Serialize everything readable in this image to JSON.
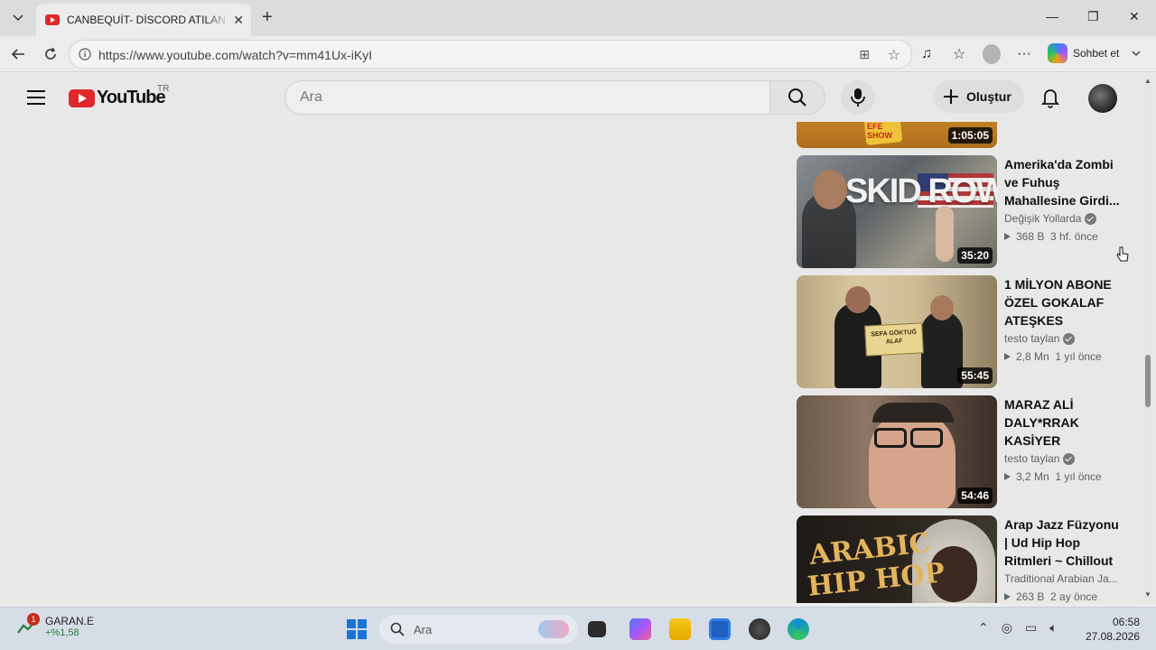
{
  "browser": {
    "tab": {
      "title": "CANBEQUİT- DİSCORD ATILAN VİDEO"
    },
    "address": {
      "url": "https://www.youtube.com/watch?v=mm41Ux-iKyI"
    },
    "chat_label": "Sohbet et"
  },
  "youtube": {
    "logo_text": "YouTube",
    "region": "TR",
    "search": {
      "placeholder": "Ara"
    },
    "create_label": "Oluştur"
  },
  "recommendations": [
    {
      "duration": "1:05:05",
      "title": "",
      "channel": "",
      "views": "",
      "age": ""
    },
    {
      "duration": "35:20",
      "title": "Amerika'da Zombi ve Fuhuş Mahallesine Girdi...",
      "channel": "Değişik Yollarda",
      "views": "368 B",
      "age": "3 hf. önce"
    },
    {
      "duration": "55:45",
      "title": "1 MİLYON ABONE ÖZEL GOKALAF ATEŞKES",
      "channel": "testo taylan",
      "views": "2,8 Mn",
      "age": "1 yıl önce"
    },
    {
      "duration": "54:46",
      "title": "MARAZ ALİ DALY*RRAK KASİYER",
      "channel": "testo taylan",
      "views": "3,2 Mn",
      "age": "1 yıl önce"
    },
    {
      "duration": "",
      "title": "Arap Jazz Füzyonu | Ud Hip Hop Ritmleri ~ Chillout",
      "channel": "Traditional Arabian Ja...",
      "views": "263 B",
      "age": "2 ay önce"
    }
  ],
  "thumb_text": {
    "efe_show": "EFE SHOW",
    "skid_row": "SKID ROW",
    "certificate": "SEFA GÖKTUĞ ALAF",
    "arabic": "ARABIC",
    "hiphop": "HIP HOP"
  },
  "taskbar": {
    "stock": {
      "badge": "1",
      "symbol": "GARAN.E",
      "change": "+%1,58"
    },
    "search_placeholder": "Ara",
    "time": "06:58",
    "date": "27.08.2026"
  }
}
